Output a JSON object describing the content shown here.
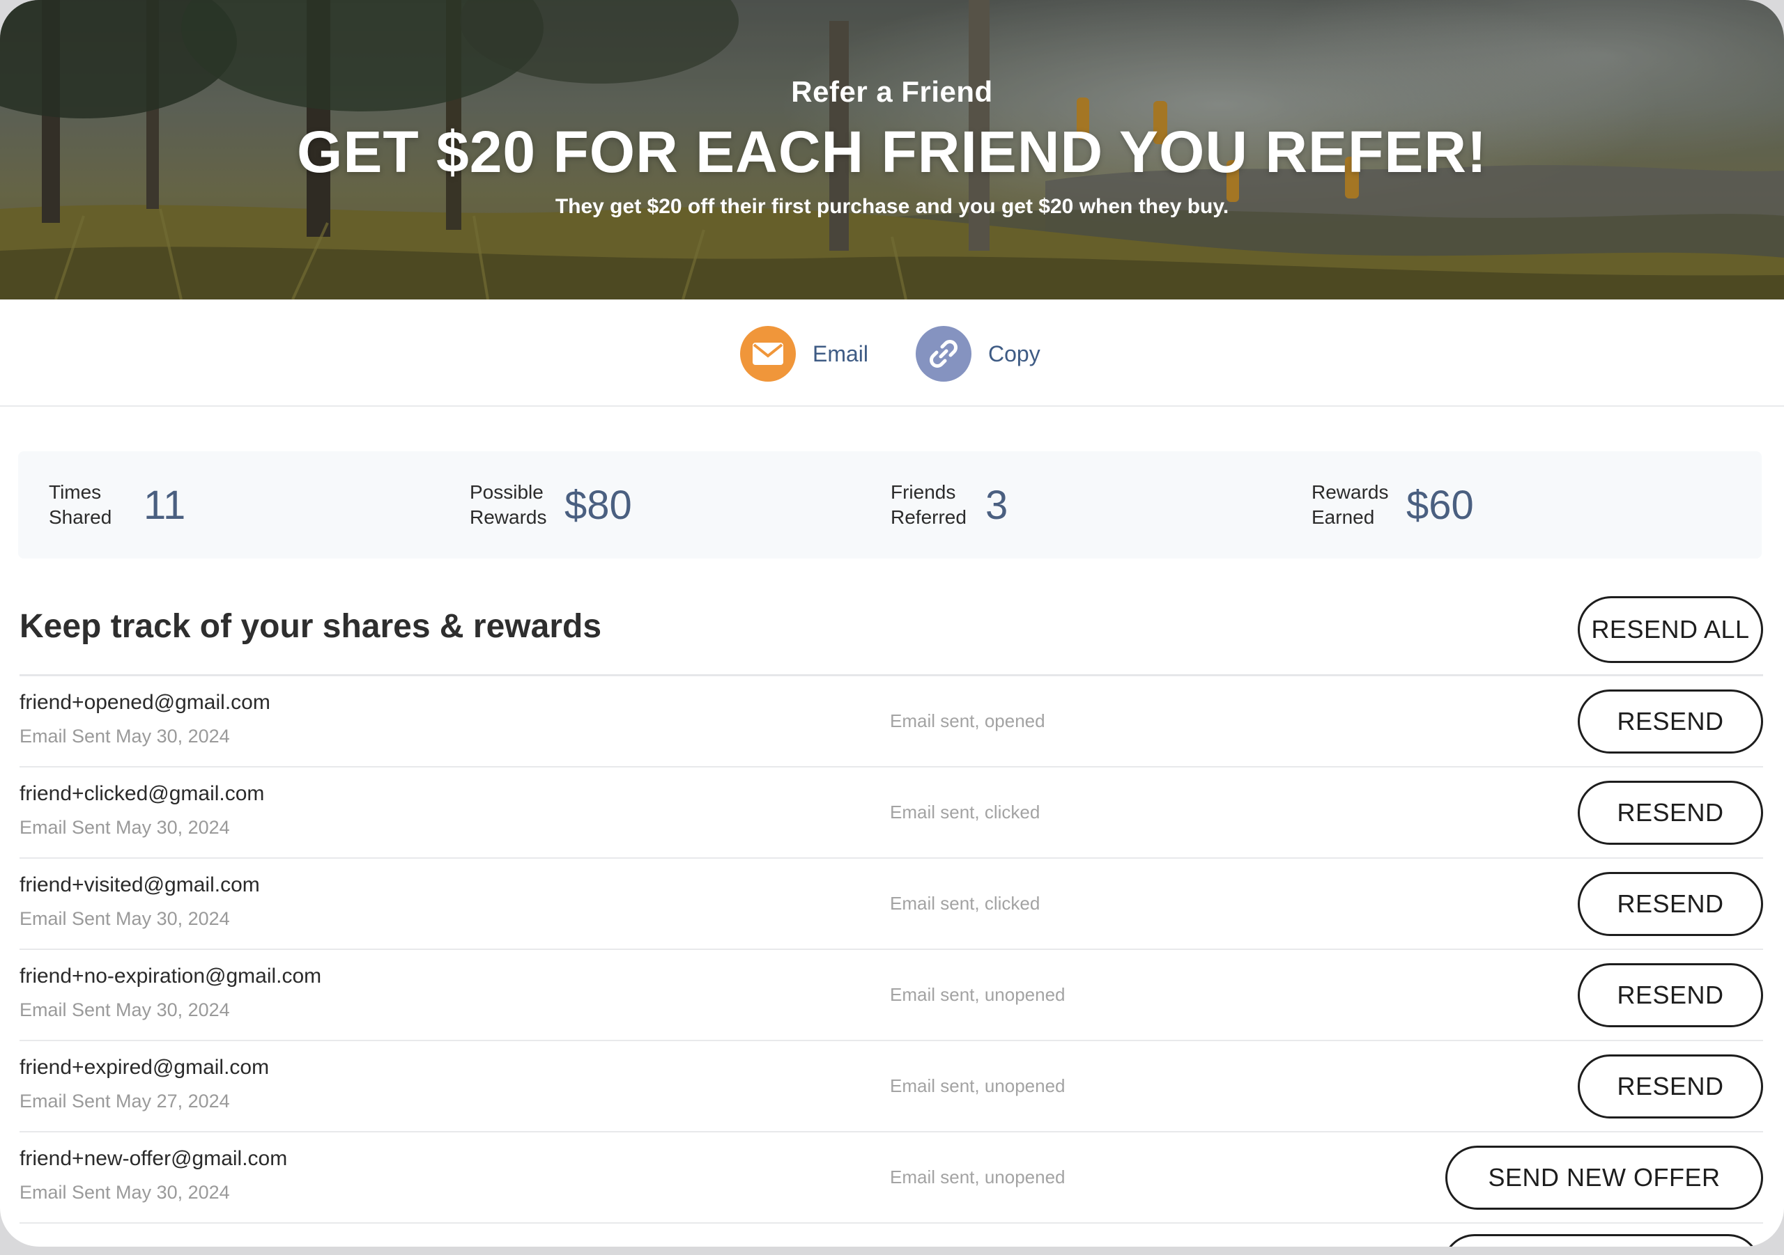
{
  "hero": {
    "eyebrow": "Refer a Friend",
    "headline": "GET $20 FOR EACH FRIEND YOU REFER!",
    "subline": "They get $20 off their first purchase and you get $20 when they buy."
  },
  "share": {
    "email": {
      "label": "Email",
      "icon": "envelope-icon",
      "color": "#f0963a"
    },
    "copy": {
      "label": "Copy",
      "icon": "link-icon",
      "color": "#8593c0"
    }
  },
  "stats": [
    {
      "caption": "Times Shared",
      "value": "11"
    },
    {
      "caption": "Possible Rewards",
      "value": "$80"
    },
    {
      "caption": "Friends Referred",
      "value": "3"
    },
    {
      "caption": "Rewards Earned",
      "value": "$60"
    }
  ],
  "list": {
    "title": "Keep track of your shares & rewards",
    "resend_all_label": "RESEND ALL",
    "rows": [
      {
        "email": "friend+opened@gmail.com",
        "sent": "Email Sent May 30, 2024",
        "status": "Email sent, opened",
        "action": "RESEND"
      },
      {
        "email": "friend+clicked@gmail.com",
        "sent": "Email Sent May 30, 2024",
        "status": "Email sent, clicked",
        "action": "RESEND"
      },
      {
        "email": "friend+visited@gmail.com",
        "sent": "Email Sent May 30, 2024",
        "status": "Email sent, clicked",
        "action": "RESEND"
      },
      {
        "email": "friend+no-expiration@gmail.com",
        "sent": "Email Sent May 30, 2024",
        "status": "Email sent, unopened",
        "action": "RESEND"
      },
      {
        "email": "friend+expired@gmail.com",
        "sent": "Email Sent May 27, 2024",
        "status": "Email sent, unopened",
        "action": "RESEND"
      },
      {
        "email": "friend+new-offer@gmail.com",
        "sent": "Email Sent May 30, 2024",
        "status": "Email sent, unopened",
        "action": "SEND NEW OFFER"
      }
    ]
  },
  "colors": {
    "accent_text": "#3e5b84",
    "stat_value": "#4a5f80",
    "button_border": "#1d1d1d"
  }
}
